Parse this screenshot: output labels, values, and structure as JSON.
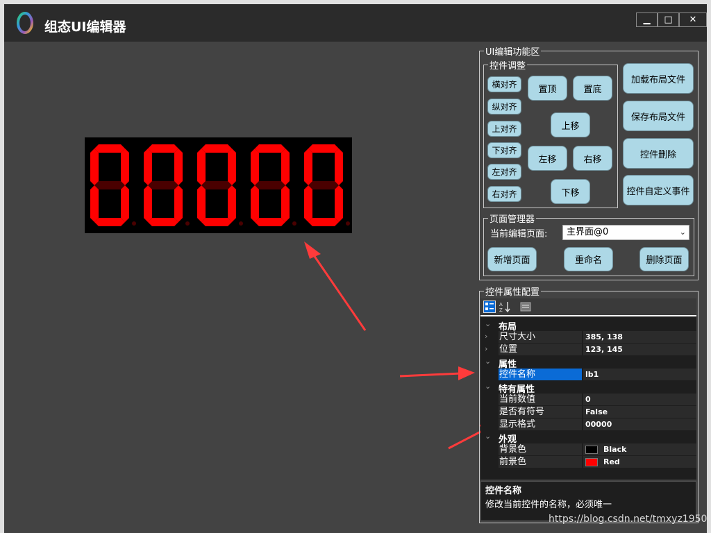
{
  "window": {
    "title": "组态UI编辑器",
    "controls": {
      "minimize": "▁",
      "maximize": "□",
      "close": "✕"
    }
  },
  "display": {
    "value": "00000",
    "background_color": "#000000",
    "foreground_color": "#ff0000"
  },
  "editor_panel": {
    "title": "UI编辑功能区",
    "adjust_group": {
      "title": "控件调整",
      "align_buttons": [
        "横对齐",
        "纵对齐",
        "上对齐",
        "下对齐",
        "左对齐",
        "右对齐"
      ],
      "bring_top": "置顶",
      "send_bottom": "置底",
      "move_up": "上移",
      "move_left": "左移",
      "move_right": "右移",
      "move_down": "下移"
    },
    "side_buttons": [
      "加载布局文件",
      "保存布局文件",
      "控件删除",
      "控件自定义事件"
    ],
    "page_manager": {
      "title": "页面管理器",
      "label": "当前编辑页面:",
      "selected_page": "主界面@0",
      "add_page": "新增页面",
      "rename": "重命名",
      "delete_page": "删除页面"
    }
  },
  "property_panel": {
    "title": "控件属性配置",
    "toolbar_icons": [
      "categorized-icon",
      "alphabetical-sort-icon",
      "property-pages-icon"
    ],
    "categories": [
      {
        "name": "布局",
        "expanded": true,
        "rows": [
          {
            "name": "尺寸大小",
            "value": "385, 138",
            "expandable": true
          },
          {
            "name": "位置",
            "value": "123, 145",
            "expandable": true
          }
        ]
      },
      {
        "name": "属性",
        "expanded": true,
        "rows": [
          {
            "name": "控件名称",
            "value": "lb1",
            "selected": true
          }
        ]
      },
      {
        "name": "特有属性",
        "expanded": true,
        "rows": [
          {
            "name": "当前数值",
            "value": "0"
          },
          {
            "name": "是否有符号",
            "value": "False"
          },
          {
            "name": "显示格式",
            "value": "00000"
          }
        ]
      },
      {
        "name": "外观",
        "expanded": true,
        "rows": [
          {
            "name": "背景色",
            "value": "Black",
            "swatch": "#000000"
          },
          {
            "name": "前景色",
            "value": "Red",
            "swatch": "#ff0000"
          }
        ]
      }
    ],
    "help": {
      "title": "控件名称",
      "description": "修改当前控件的名称，必须唯一"
    }
  },
  "watermark": "https://blog.csdn.net/tmxyz1950",
  "colors": {
    "canvas": "#434343",
    "titlebar": "#2b2b2b",
    "button": "#add8e6",
    "selection": "#0a6bd6",
    "annotation_arrow": "#ff3b3b"
  }
}
